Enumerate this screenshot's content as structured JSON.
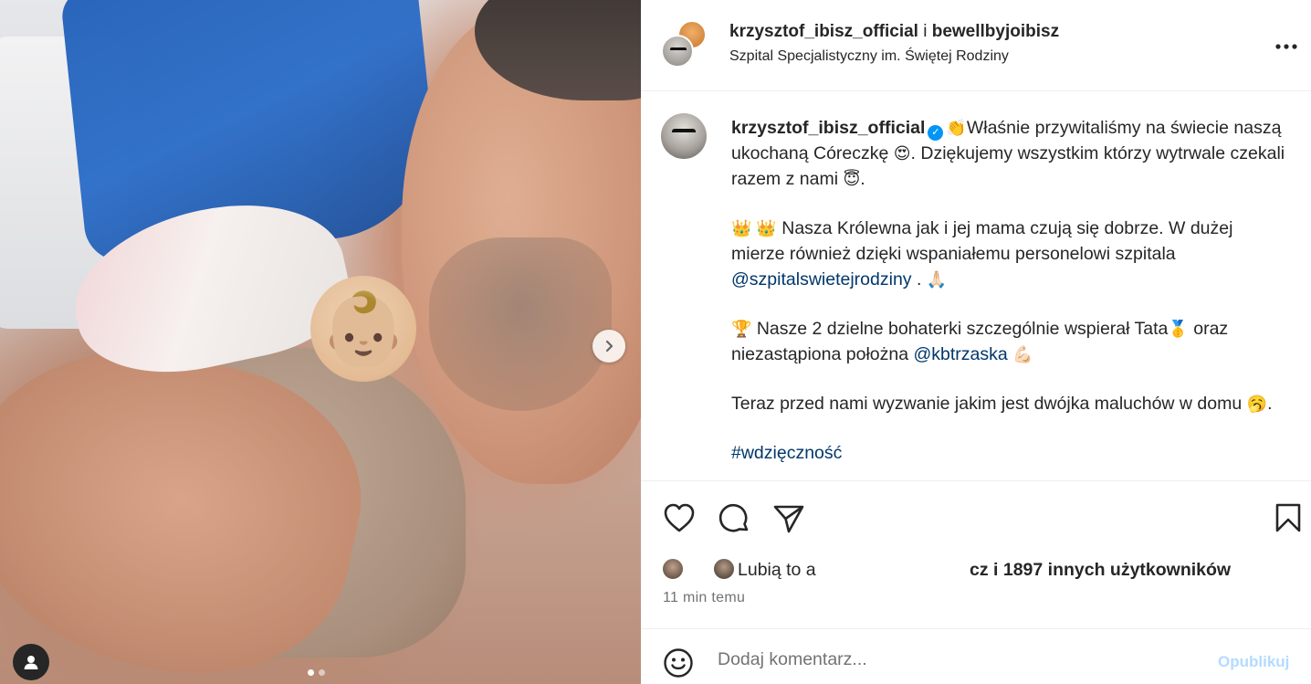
{
  "post": {
    "owners": {
      "user1": "krzysztof_ibisz_official",
      "separator": " i ",
      "user2": "bewellbyjoibisz"
    },
    "location": "Szpital Specjalistyczny im. Świętej Rodziny",
    "more_icon": "more-horizontal-icon"
  },
  "media": {
    "emoji_cover": "👶🏼",
    "carousel": {
      "current_slide": 1,
      "total_slides": 2
    },
    "next_icon": "chevron-right-icon",
    "tag_icon": "user-tag-icon"
  },
  "caption": {
    "username": "krzysztof_ibisz_official",
    "verified_icon": "verified-badge-icon",
    "p1_emoji1": "👏",
    "p1_text1": "Właśnie przywitaliśmy na świecie naszą ukochaną Córeczkę ",
    "p1_emoji2": "😍",
    "p1_text2": ". Dziękujemy wszystkim którzy wytrwale czekali razem z nami ",
    "p1_emoji3": "😇",
    "p1_text3": ".",
    "p2_emoji": "👑 👑",
    "p2_text1": " Nasza Królewna jak i jej mama czują się dobrze. W dużej mierze również dzięki wspaniałemu personelowi szpitala ",
    "p2_mention": "@szpitalswietejrodziny",
    "p2_text2": " . ",
    "p2_emoji2": "🙏🏻",
    "p3_emoji1": "🏆",
    "p3_text1": " Nasze 2 dzielne bohaterki szczególnie wspierał Tata",
    "p3_emoji2": "🥇",
    "p3_text2": "  oraz niezastąpiona położna ",
    "p3_mention": "@kbtrzaska",
    "p3_text3": " ",
    "p3_emoji3": "💪🏻",
    "p4_text1": "Teraz przed nami wyzwanie jakim jest dwójka maluchów w domu ",
    "p4_emoji": "🥱",
    "p4_text2": ".",
    "hashtag": "#wdzięczność"
  },
  "actions": {
    "like_icon": "heart-icon",
    "comment_icon": "comment-icon",
    "share_icon": "share-icon",
    "save_icon": "bookmark-icon"
  },
  "likes": {
    "prefix": "Lubią to a",
    "suffix": "cz i 1897 innych użytkowników"
  },
  "timestamp": "11 min temu",
  "comment": {
    "emoji_icon": "smiley-icon",
    "placeholder": "Dodaj komentarz...",
    "publish_label": "Opublikuj"
  },
  "colors": {
    "link": "#00376b",
    "verified": "#0095f6",
    "publish_disabled": "#b3dbff",
    "muted_text": "#737373"
  }
}
